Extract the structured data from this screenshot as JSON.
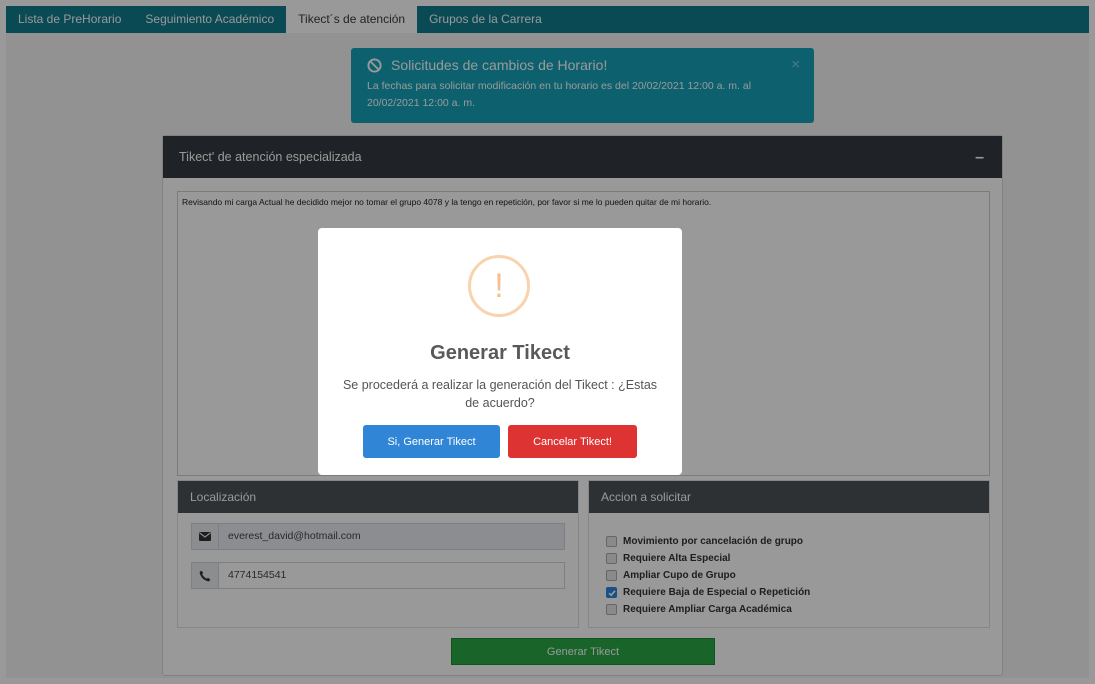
{
  "tabs": [
    {
      "label": "Lista de PreHorario"
    },
    {
      "label": "Seguimiento Académico"
    },
    {
      "label": "Tikect´s de atención"
    },
    {
      "label": "Grupos de la Carrera"
    }
  ],
  "alert": {
    "title": "Solicitudes de cambios de Horario!",
    "text": "La fechas para solicitar modificación en tu horario es del 20/02/2021 12:00 a. m. al 20/02/2021 12:00 a. m.",
    "close": "×",
    "icon": "ban-icon"
  },
  "card": {
    "title": "Tikect' de atención especializada",
    "collapse": "–",
    "message": "Revisando mi carga Actual he decidido mejor no tomar el grupo  4078 y la tengo en repetición, por favor si me lo pueden quitar de mi horario."
  },
  "location": {
    "title": "Localización",
    "email": "everest_david@hotmail.com",
    "phone": "4774154541"
  },
  "actions": {
    "title": "Accion a solicitar",
    "options": [
      {
        "label": "Movimiento por cancelación de grupo",
        "checked": false
      },
      {
        "label": "Requiere Alta Especial",
        "checked": false
      },
      {
        "label": "Ampliar Cupo de Grupo",
        "checked": false
      },
      {
        "label": "Requiere Baja de Especial o Repetición",
        "checked": true
      },
      {
        "label": "Requiere Ampliar Carga Académica",
        "checked": false
      }
    ]
  },
  "generate_button": "Generar Tikect",
  "modal": {
    "icon_glyph": "!",
    "title": "Generar Tikect",
    "text": "Se procederá a realizar la generación del Tikect : ¿Estas de acuerdo?",
    "confirm": "Si, Generar Tikect",
    "cancel": "Cancelar Tikect!"
  },
  "colors": {
    "nav": "#0f7c8e",
    "alert": "#17a2b8",
    "header": "#343a40",
    "confirm": "#3085d6",
    "cancel": "#dd3333",
    "generate": "#28a745"
  }
}
